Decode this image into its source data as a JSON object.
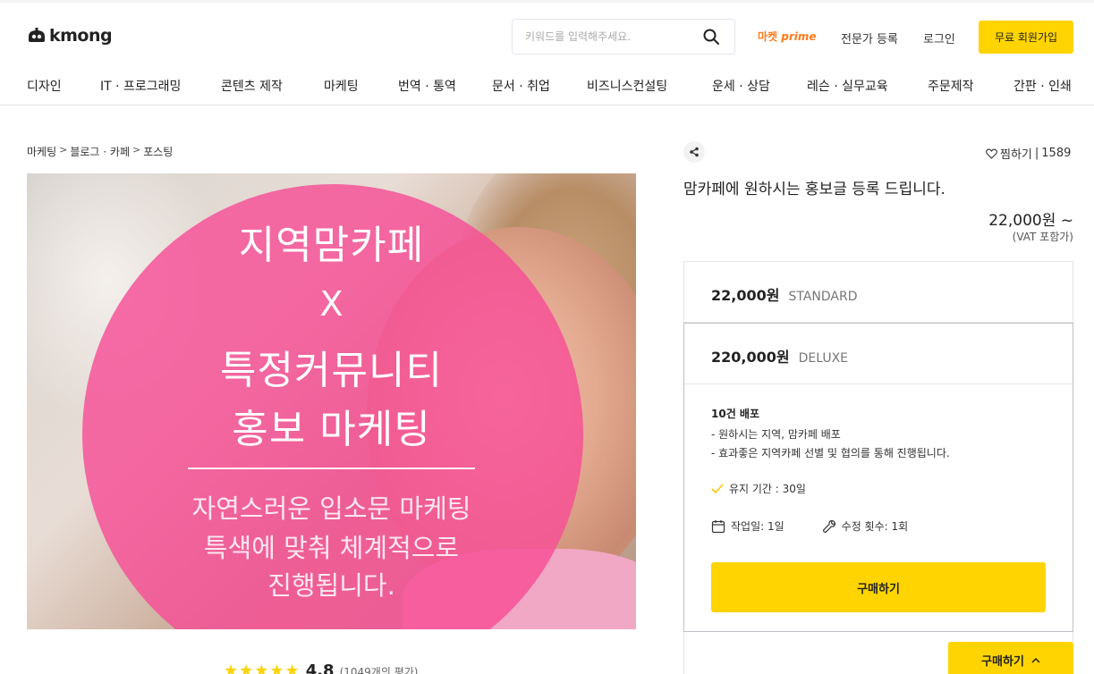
{
  "header": {
    "logo_text": "kmong",
    "search_placeholder": "키워드를 입력해주세요.",
    "prime_prefix": "마켓",
    "prime_suffix": "prime",
    "expert_register": "전문가 등록",
    "login": "로그인",
    "signup": "무료 회원가입"
  },
  "categories": [
    "디자인",
    "IT · 프로그래밍",
    "콘텐츠 제작",
    "마케팅",
    "번역 · 통역",
    "문서 · 취업",
    "비즈니스컨설팅",
    "운세 · 상담",
    "레슨 · 실무교육",
    "주문제작",
    "간판 · 인쇄"
  ],
  "breadcrumb": [
    "마케팅",
    "블로그 · 카페",
    "포스팅"
  ],
  "hero": {
    "line1": "지역맘카페",
    "line2": "X",
    "line3": "특정커뮤니티",
    "line4": "홍보 마케팅",
    "sub1": "자연스러운 입소문 마케팅",
    "sub2": "특색에 맞춰 체계적으로",
    "sub3": "진행됩니다."
  },
  "rating": {
    "stars": "★★★★★",
    "score": "4.8",
    "count": "(1049개의 평가)"
  },
  "service": {
    "favorite_label": "찜하기",
    "favorite_count": "1589",
    "title": "맘카페에 원하시는 홍보글 등록 드립니다.",
    "price": "22,000원 ~",
    "vat": "(VAT 포함가)"
  },
  "packages": {
    "standard": {
      "price": "22,000원",
      "tier": "STANDARD"
    },
    "deluxe": {
      "price": "220,000원",
      "tier": "DELUXE",
      "name": "10건 배포",
      "desc1": "- 원하시는 지역, 맘카페 배포",
      "desc2": "- 효과좋은 지역카페 선별 및 협의를 통해 진행됩니다.",
      "keep_period": "유지 기간 : 30일",
      "work_days": "작업일: 1일",
      "revisions": "수정 횟수: 1회",
      "buy_label": "구매하기"
    }
  },
  "floating_buy": "구매하기",
  "colors": {
    "accent": "#ffd400",
    "prime": "#ff7a1a",
    "hero_circle": "#f64e96"
  }
}
